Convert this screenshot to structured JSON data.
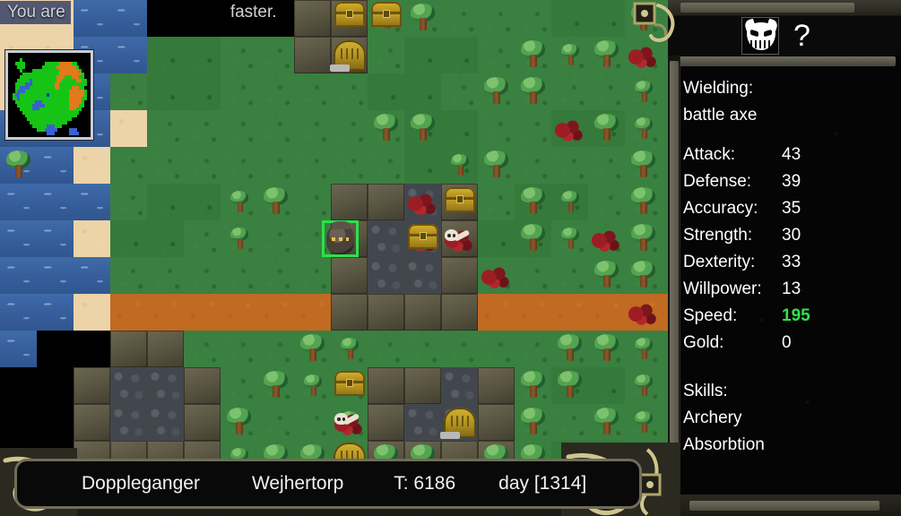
{
  "message": {
    "text_before": "You are",
    "text_after": "faster.",
    "obscured": true
  },
  "minimap": {
    "name": "world-minimap",
    "colors": {
      "land": "#16c416",
      "road": "#e07a1a",
      "water": "#3a5fd0",
      "player": "#1a3ad8",
      "void": "#000000"
    }
  },
  "panel": {
    "monster_icon": "demon-face-icon",
    "unknown_marker": "?",
    "wielding_label": "Wielding:",
    "wielding_value": "battle axe",
    "stats": [
      {
        "label": "Attack:",
        "value": "43",
        "highlight": false
      },
      {
        "label": "Defense:",
        "value": "39",
        "highlight": false
      },
      {
        "label": "Accuracy:",
        "value": "35",
        "highlight": false
      },
      {
        "label": "Strength:",
        "value": "30",
        "highlight": false
      },
      {
        "label": "Dexterity:",
        "value": "33",
        "highlight": false
      },
      {
        "label": "Willpower:",
        "value": "13",
        "highlight": false
      },
      {
        "label": "Speed:",
        "value": "195",
        "highlight": true
      },
      {
        "label": "Gold:",
        "value": "0",
        "highlight": false
      }
    ],
    "skills_label": "Skills:",
    "skills": [
      "Archery",
      "Absorbtion"
    ],
    "speed_color": "#2ee34a"
  },
  "statusbar": {
    "character": "Doppleganger",
    "location": "Wejhertorp",
    "turn": "T: 6186",
    "day": "day [1314]"
  },
  "map": {
    "player_tile": "player-character",
    "selection_color": "#29e34a",
    "terrain_legend": {
      "grass": "#3a8040",
      "water": "#375f9c",
      "sand": "#edd3a8",
      "dirt_road": "#c16a22",
      "stone_floor": "#42464d",
      "wall": "#575340",
      "unexplored": "#000000"
    }
  }
}
